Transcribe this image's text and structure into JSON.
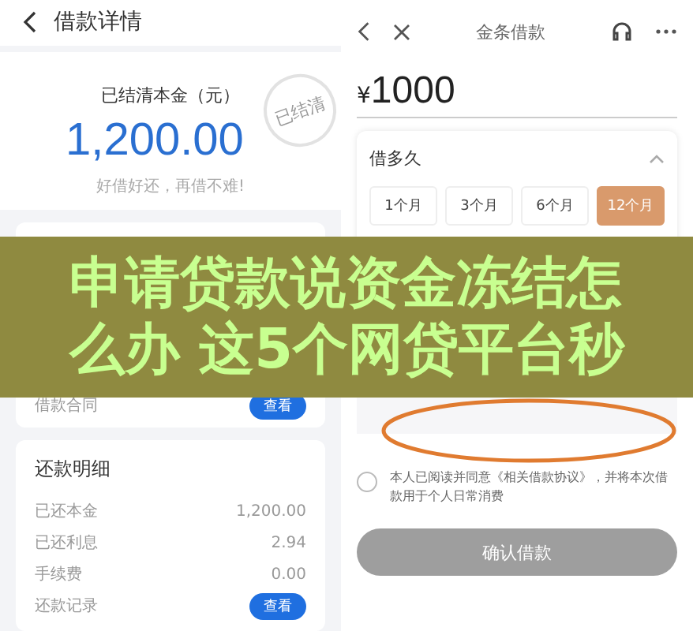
{
  "left_screen": {
    "title": "借款详情",
    "summary": {
      "label": "已结清本金（元）",
      "amount": "1,200.00",
      "slogan": "好借好还，再借不难!",
      "stamp": "已结清"
    },
    "loan_details": {
      "rows": [
        {
          "label": "借款合同",
          "action": "查看"
        }
      ]
    },
    "repayment_details": {
      "title": "还款明细",
      "rows": [
        {
          "label": "已还本金",
          "value": "1,200.00"
        },
        {
          "label": "已还利息",
          "value": "2.94"
        },
        {
          "label": "手续费",
          "value": "0.00"
        },
        {
          "label": "还款记录",
          "action": "查看"
        }
      ]
    }
  },
  "right_screen": {
    "title": "金条借款",
    "amount": "1000",
    "currency": "¥",
    "term": {
      "label": "借多久",
      "expanded": true,
      "options": [
        {
          "label": "1个月",
          "selected": false
        },
        {
          "label": "3个月",
          "selected": false
        },
        {
          "label": "6个月",
          "selected": false
        },
        {
          "label": "12个月",
          "selected": true
        }
      ]
    },
    "agreement": {
      "checked": false,
      "text": "本人已阅读并同意《相关借款协议》，并将本次借款用于个人日常消费"
    },
    "confirm_button": {
      "label": "确认借款",
      "disabled": true
    }
  },
  "headline": {
    "lines": [
      "申请贷款说资金冻结怎",
      "么办 这5个网贷平台秒"
    ]
  }
}
